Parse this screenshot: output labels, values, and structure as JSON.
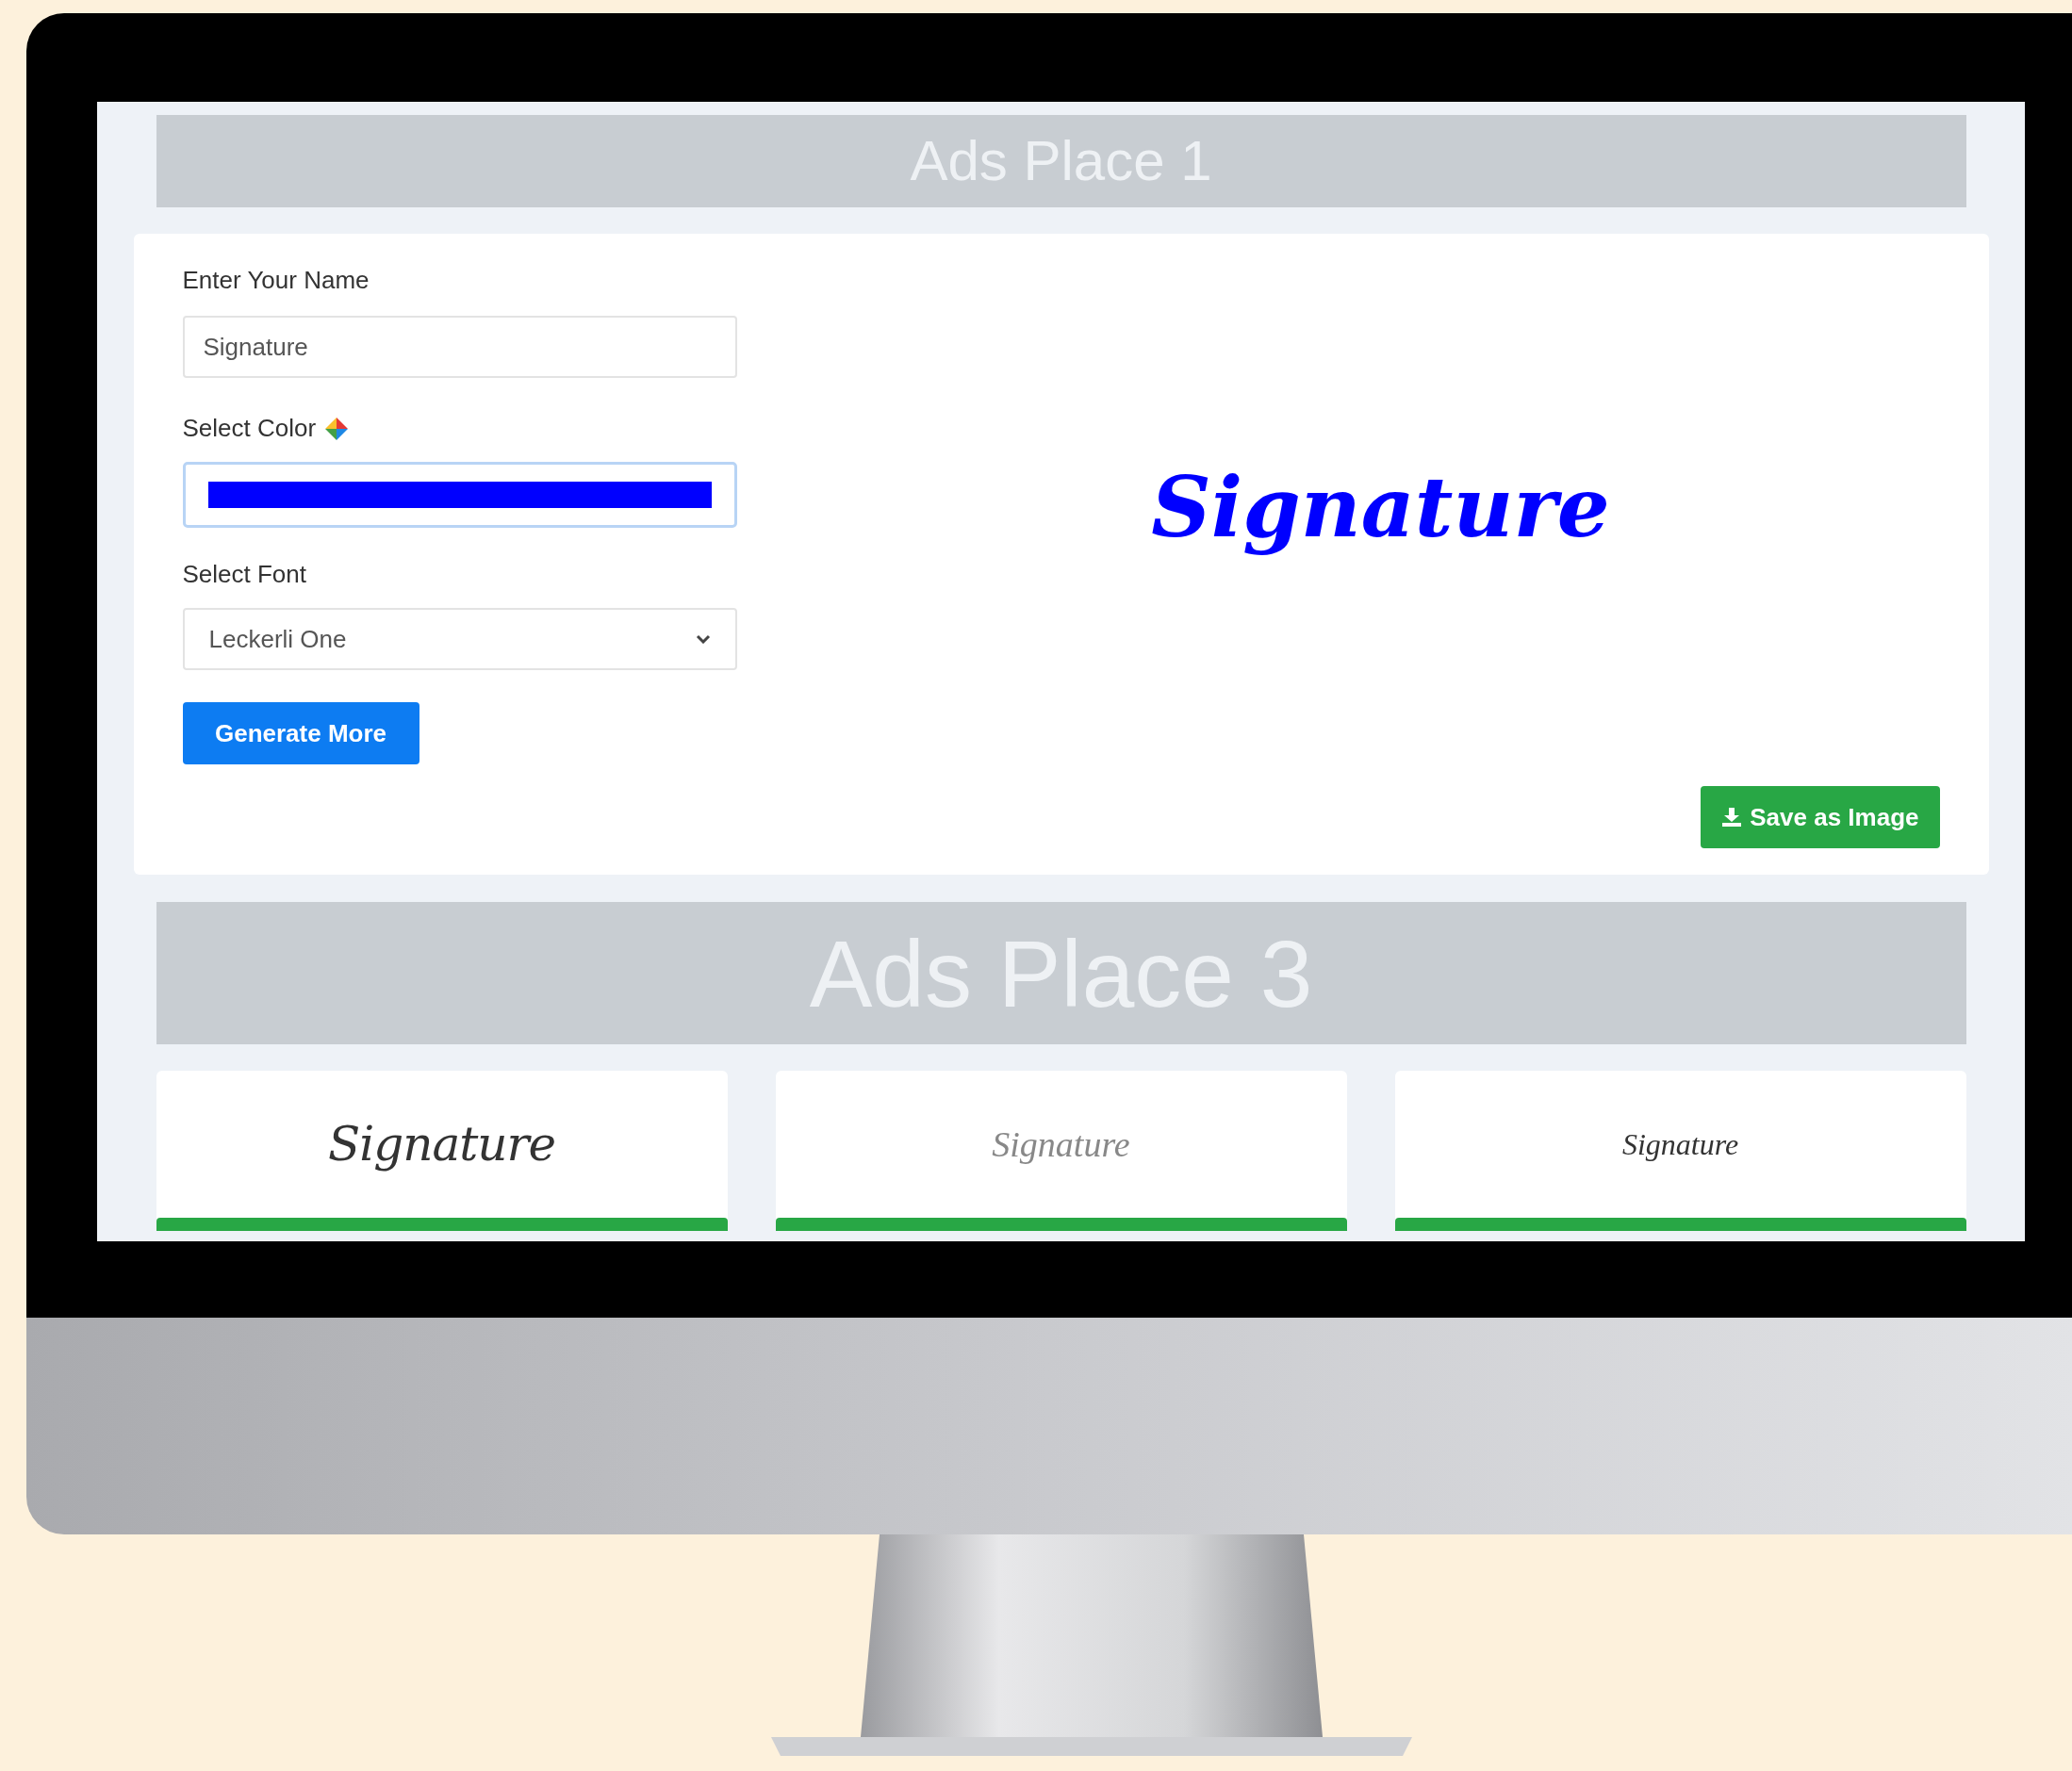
{
  "ads_top": {
    "label": "Ads Place 1"
  },
  "form": {
    "name_label": "Enter Your Name",
    "name_value": "Signature",
    "color_label": "Select Color",
    "color": "#0000ff",
    "font_label": "Select Font",
    "font_value": "Leckerli One",
    "generate_button": "Generate More"
  },
  "preview": {
    "text": "Signature",
    "save_button": "Save as Image"
  },
  "ads_bottom": {
    "label": "Ads Place 3"
  },
  "samples": [
    {
      "text": "Signature"
    },
    {
      "text": "Signature"
    },
    {
      "text": "Signature"
    }
  ]
}
